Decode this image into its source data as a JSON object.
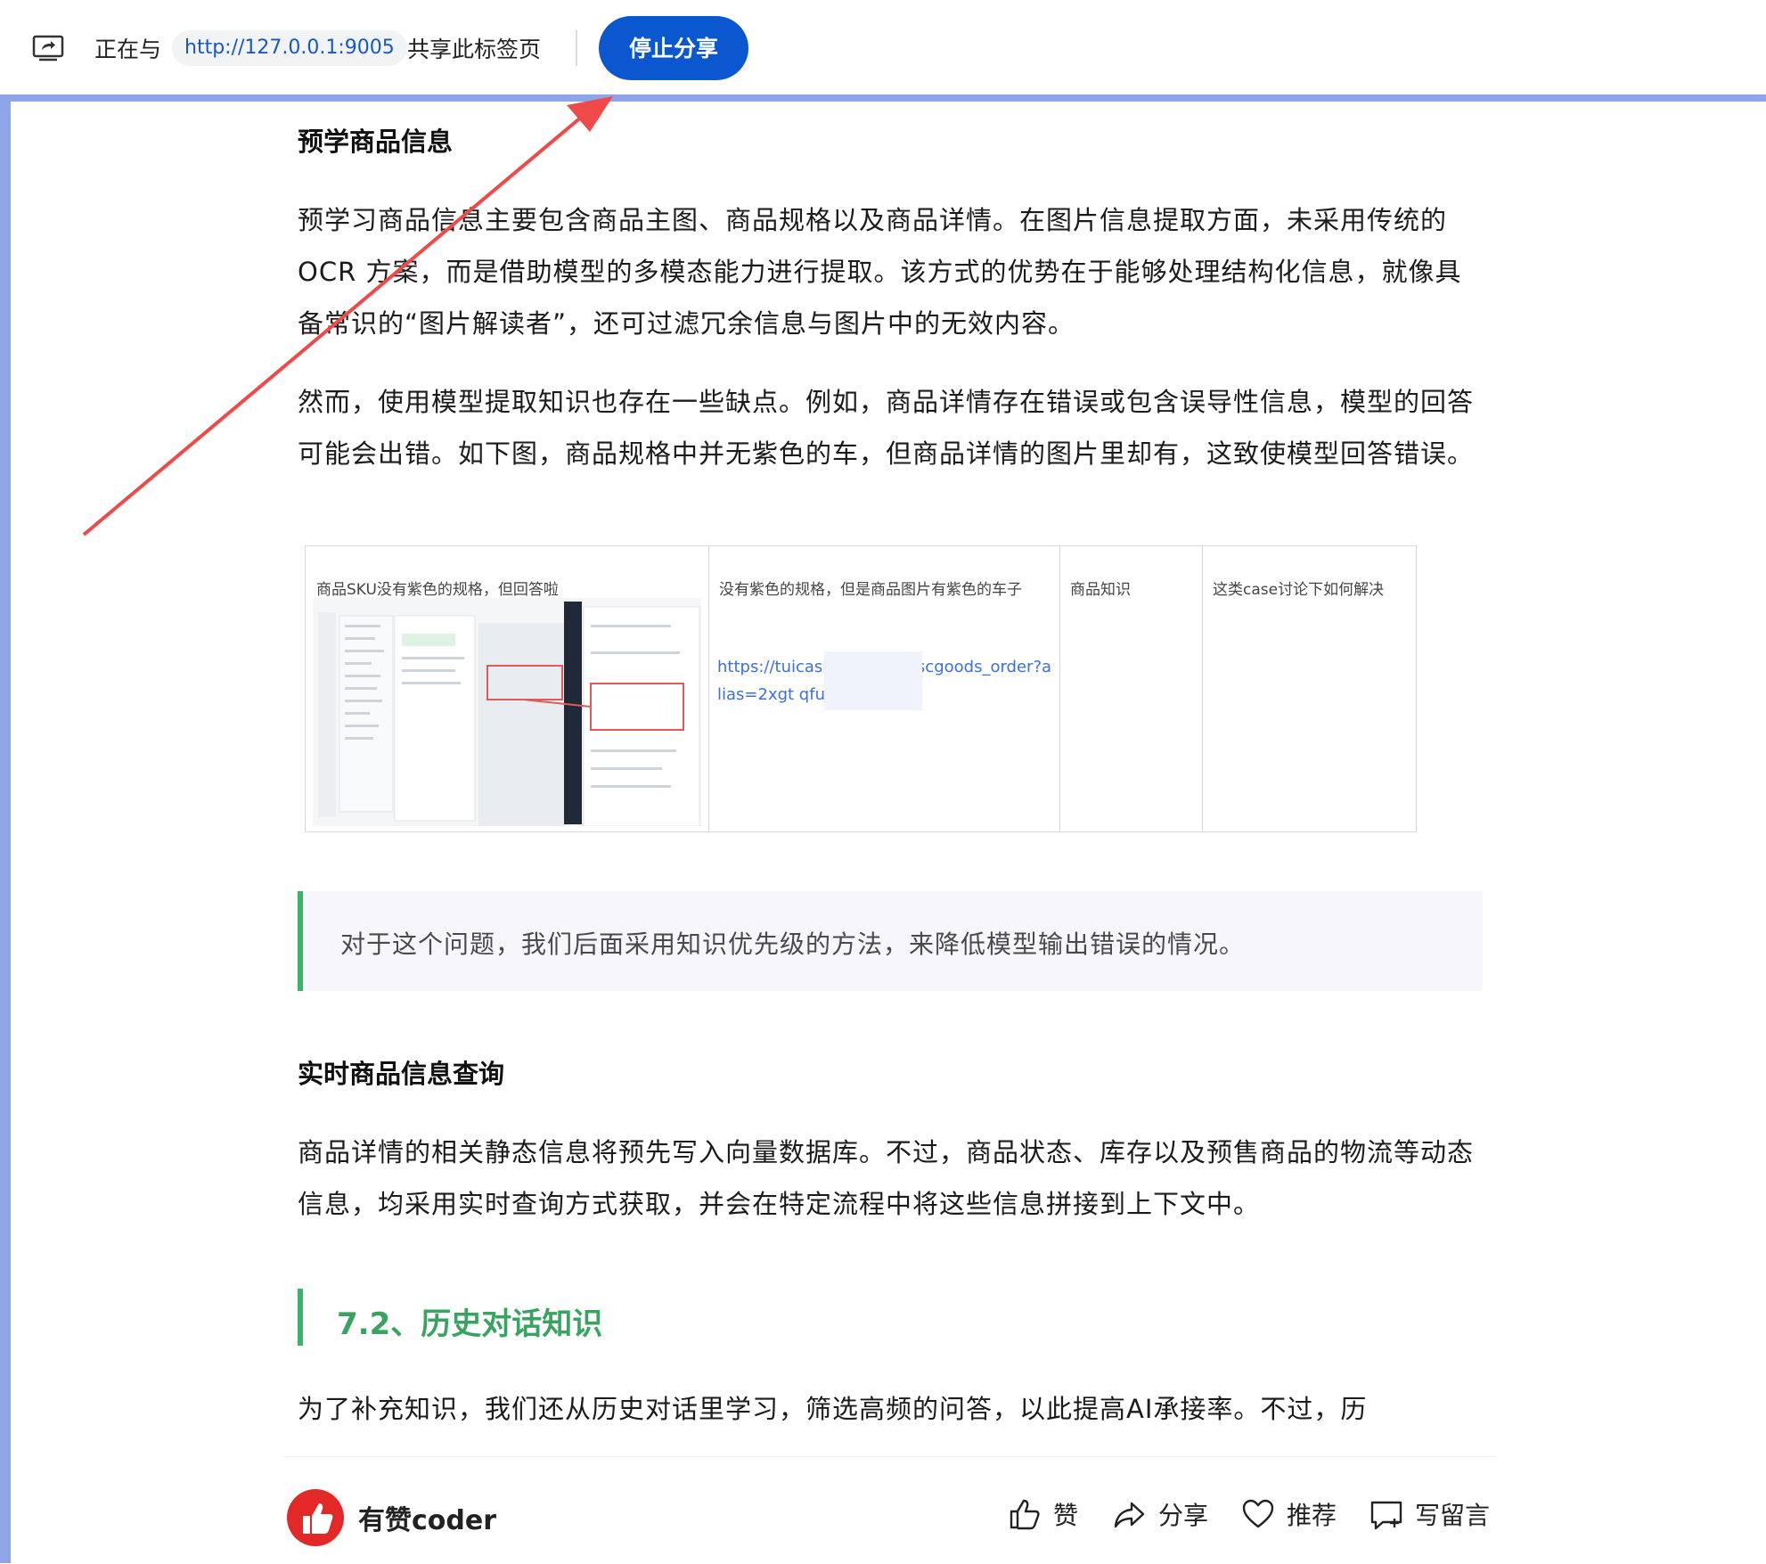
{
  "share_bar": {
    "prefix": "正在与",
    "url": "http://127.0.0.1:9005",
    "suffix": "共享此标签页",
    "stop_label": "停止分享",
    "icon": "screen-share-icon",
    "accent_color": "#0b57d0"
  },
  "article": {
    "heading_prelearn": "预学商品信息",
    "para1": "预学习商品信息主要包含商品主图、商品规格以及商品详情。在图片信息提取方面，未采用传统的 OCR 方案，而是借助模型的多模态能力进行提取。该方式的优势在于能够处理结构化信息，就像具备常识的“图片解读者”，还可过滤冗余信息与图片中的无效内容。",
    "para2": "然而，使用模型提取知识也存在一些缺点。例如，商品详情存在错误或包含误导性信息，模型的回答可能会出错。如下图，商品规格中并无紫色的车，但商品详情的图片里却有，这致使模型回答错误。",
    "table": {
      "headers": [
        "商品SKU没有紫色的规格，但回答啦",
        "没有紫色的规格，但是商品图片有紫色的车子",
        "商品知识",
        "这类case讨论下如何解决"
      ],
      "link_text": "https://tuicash            om/pay/wscgoods_order?alias=2xgt          qfu1"
    },
    "quote": "对于这个问题，我们后面采用知识优先级的方法，来降低模型输出错误的情况。",
    "heading_realtime": "实时商品信息查询",
    "para3": "商品详情的相关静态信息将预先写入向量数据库。不过，商品状态、库存以及预售商品的物流等动态信息，均采用实时查询方式获取，并会在特定流程中将这些信息拼接到上下文中。",
    "section_title": "7.2、历史对话知识",
    "section_color": "#3aa361",
    "para4": "为了补充知识，我们还从历史对话里学习，筛选高频的问答，以此提高AI承接率。不过，历"
  },
  "bottom_bar": {
    "author": "有赞coder",
    "avatar_icon": "thumbs-up-logo-icon",
    "like_label": "赞",
    "share_label": "分享",
    "recommend_label": "推荐",
    "comment_label": "写留言"
  },
  "annotation_color": "#ef4a4a"
}
